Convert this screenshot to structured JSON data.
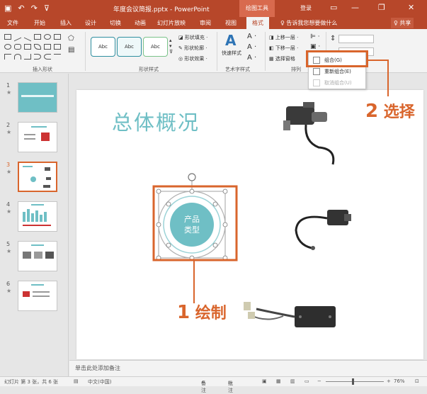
{
  "titlebar": {
    "title": "年度会议简报.pptx - PowerPoint",
    "context_tab": "绘图工具",
    "login": "登录",
    "minimize": "—",
    "restore": "❐",
    "close": "✕"
  },
  "tabs": [
    {
      "label": "文件"
    },
    {
      "label": "开始"
    },
    {
      "label": "插入"
    },
    {
      "label": "设计"
    },
    {
      "label": "切换"
    },
    {
      "label": "动画"
    },
    {
      "label": "幻灯片放映"
    },
    {
      "label": "审阅"
    },
    {
      "label": "视图"
    },
    {
      "label": "格式"
    }
  ],
  "tellme": "♀ 告诉我您想要做什么",
  "share": "♀ 共享",
  "ribbon": {
    "groups": [
      "插入形状",
      "形状样式",
      "艺术字样式",
      "排列"
    ],
    "style_boxes": [
      "Abc",
      "Abc",
      "Abc"
    ],
    "fill": "形状填充 ·",
    "outline": "形状轮廓 ·",
    "effect": "形状效果 ·",
    "quick_styles": "快速样式",
    "bring_forward": "上移一层 ·",
    "send_backward": "下移一层 ·",
    "selection_pane": "选择窗格"
  },
  "dropdown": {
    "items": [
      {
        "label": "组合(G)"
      },
      {
        "label": "重新组合(E)"
      },
      {
        "label": "取消组合(U)"
      }
    ]
  },
  "thumbnails": [
    {
      "num": "1",
      "star": "★"
    },
    {
      "num": "2",
      "star": "★"
    },
    {
      "num": "3",
      "star": "★"
    },
    {
      "num": "4",
      "star": "★"
    },
    {
      "num": "5",
      "star": "★"
    },
    {
      "num": "6",
      "star": "★"
    }
  ],
  "slide": {
    "title": "总体概况",
    "circle_text_1": "产品",
    "circle_text_2": "类型"
  },
  "callouts": {
    "one_num": "1",
    "one_text": "绘制",
    "two_num": "2",
    "two_text": "选择"
  },
  "notes_placeholder": "单击此处添加备注",
  "status": {
    "slide_info": "幻灯片 第 3 张，共 6 张",
    "language": "中文(中国)",
    "notes": "备注",
    "comments": "批注",
    "zoom": "76%"
  },
  "colors": {
    "accent": "#b7472a",
    "highlight": "#d9652c",
    "teal": "#6fbfc5"
  }
}
